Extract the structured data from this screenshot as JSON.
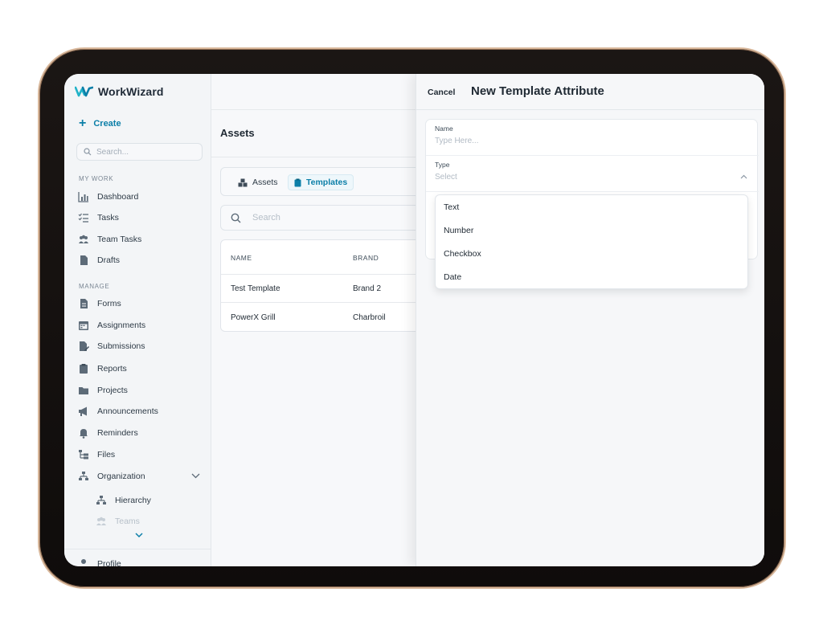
{
  "app": {
    "name": "WorkWizard"
  },
  "sidebar": {
    "create_label": "Create",
    "search_placeholder": "Search...",
    "sections": {
      "my_work": "MY WORK",
      "manage": "MANAGE"
    },
    "my_work_items": [
      {
        "label": "Dashboard",
        "icon": "chart-icon"
      },
      {
        "label": "Tasks",
        "icon": "checklist-icon"
      },
      {
        "label": "Team Tasks",
        "icon": "people-icon"
      },
      {
        "label": "Drafts",
        "icon": "document-icon"
      }
    ],
    "manage_items": [
      {
        "label": "Forms",
        "icon": "form-icon"
      },
      {
        "label": "Assignments",
        "icon": "calendar-icon"
      },
      {
        "label": "Submissions",
        "icon": "edit-document-icon"
      },
      {
        "label": "Reports",
        "icon": "clipboard-icon"
      },
      {
        "label": "Projects",
        "icon": "folder-icon"
      },
      {
        "label": "Announcements",
        "icon": "megaphone-icon"
      },
      {
        "label": "Reminders",
        "icon": "bell-icon"
      },
      {
        "label": "Files",
        "icon": "file-tree-icon"
      },
      {
        "label": "Organization",
        "icon": "org-chart-icon"
      }
    ],
    "organization_children": [
      {
        "label": "Hierarchy",
        "icon": "hierarchy-icon"
      },
      {
        "label": "Teams",
        "icon": "teams-icon"
      }
    ],
    "footer_item": {
      "label": "Profile",
      "icon": "user-icon"
    }
  },
  "main": {
    "title": "Assets",
    "tabs": [
      {
        "label": "Assets",
        "icon": "boxes-icon",
        "active": false
      },
      {
        "label": "Templates",
        "icon": "clipboard-icon",
        "active": true
      }
    ],
    "search_placeholder": "Search",
    "table": {
      "columns": [
        "NAME",
        "BRAND"
      ],
      "rows": [
        [
          "Test Template",
          "Brand 2"
        ],
        [
          "PowerX Grill",
          "Charbroil"
        ]
      ]
    }
  },
  "panel": {
    "cancel_label": "Cancel",
    "title": "New Template Attribute",
    "fields": {
      "name": {
        "label": "Name",
        "placeholder": "Type Here..."
      },
      "type": {
        "label": "Type",
        "placeholder": "Select"
      }
    },
    "type_options": [
      "Text",
      "Number",
      "Checkbox",
      "Date"
    ]
  },
  "colors": {
    "accent": "#0b7fa8",
    "text": "#1f2933",
    "muted": "#b1bac4"
  }
}
